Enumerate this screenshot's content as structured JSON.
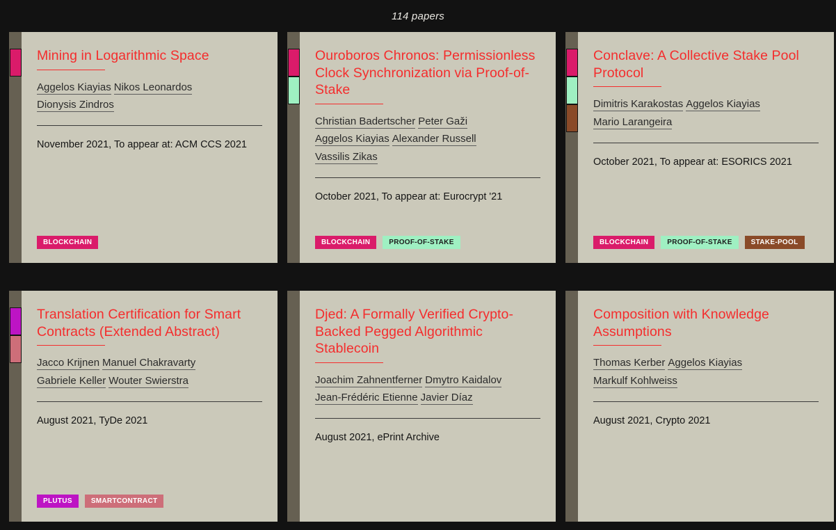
{
  "header": {
    "paper_count": "114 papers"
  },
  "colors": {
    "page_bg": "#121212",
    "card_bg": "#cbc9ba",
    "gutter": "#666052",
    "title": "#f42d2d",
    "blockchain": "#da1b6a",
    "proof_of_stake": "#9ff0c2",
    "stake_pool": "#8a4a28",
    "plutus": "#bd14c4",
    "smartcontract": "#cd6e79"
  },
  "tag_styles": {
    "BLOCKCHAIN": {
      "bg": "#da1b6a",
      "fg": "#ffffff"
    },
    "PROOF-OF-STAKE": {
      "bg": "#9ff0c2",
      "fg": "#1c1c1c"
    },
    "STAKE-POOL": {
      "bg": "#8a4a28",
      "fg": "#ffffff"
    },
    "PLUTUS": {
      "bg": "#bd14c4",
      "fg": "#ffffff"
    },
    "SMARTCONTRACT": {
      "bg": "#cd6e79",
      "fg": "#ffffff"
    }
  },
  "cards": [
    {
      "title": "Mining in Logarithmic Space",
      "authors": [
        "Aggelos Kiayias",
        "Nikos Leonardos",
        "Dionysis Zindros"
      ],
      "venue": "November 2021, To appear at: ACM CCS 2021",
      "tags": [
        "BLOCKCHAIN"
      ]
    },
    {
      "title": "Ouroboros Chronos: Permissionless Clock Synchronization via Proof-of-Stake",
      "authors": [
        "Christian Badertscher",
        "Peter Gaži",
        "Aggelos Kiayias",
        "Alexander Russell",
        "Vassilis Zikas"
      ],
      "venue": "October 2021, To appear at: Eurocrypt '21",
      "tags": [
        "BLOCKCHAIN",
        "PROOF-OF-STAKE"
      ]
    },
    {
      "title": "Conclave: A Collective Stake Pool Protocol",
      "authors": [
        "Dimitris Karakostas",
        "Aggelos Kiayias",
        "Mario Larangeira"
      ],
      "venue": "October 2021, To appear at: ESORICS 2021",
      "tags": [
        "BLOCKCHAIN",
        "PROOF-OF-STAKE",
        "STAKE-POOL"
      ]
    },
    {
      "title": "Translation Certification for Smart Contracts (Extended Abstract)",
      "authors": [
        "Jacco Krijnen",
        "Manuel Chakravarty",
        "Gabriele Keller",
        "Wouter Swierstra"
      ],
      "venue": "August 2021, TyDe 2021",
      "tags": [
        "PLUTUS",
        "SMARTCONTRACT"
      ]
    },
    {
      "title": "Djed: A Formally Verified Crypto-Backed Pegged Algorithmic Stablecoin",
      "authors": [
        "Joachim Zahnentferner",
        "Dmytro Kaidalov",
        "Jean-Frédéric Etienne",
        "Javier Díaz"
      ],
      "venue": "August 2021, ePrint Archive",
      "tags": []
    },
    {
      "title": "Composition with Knowledge Assumptions",
      "authors": [
        "Thomas Kerber",
        "Aggelos Kiayias",
        "Markulf Kohlweiss"
      ],
      "venue": "August 2021, Crypto 2021",
      "tags": []
    }
  ]
}
